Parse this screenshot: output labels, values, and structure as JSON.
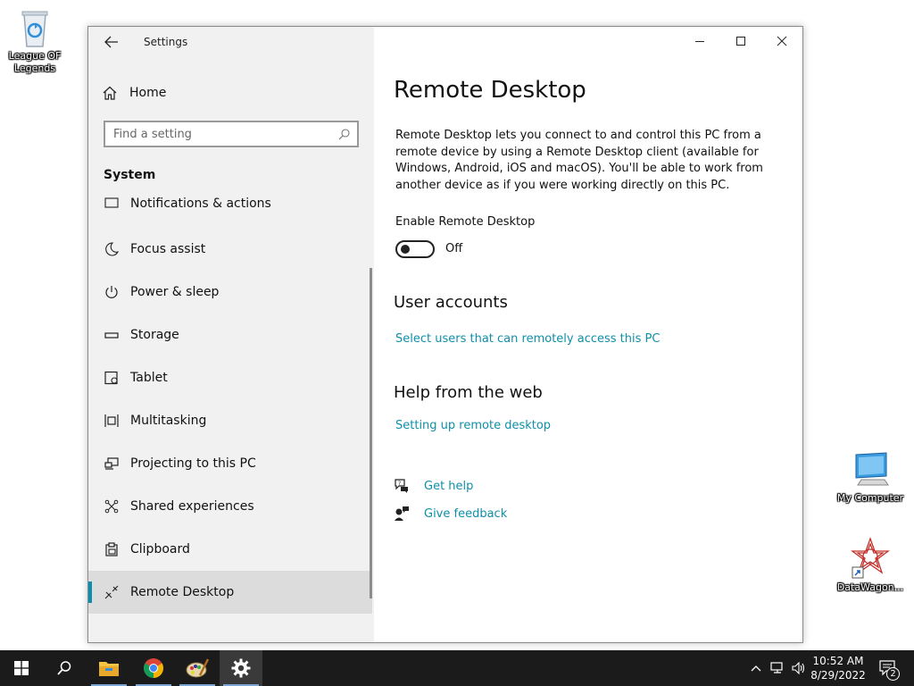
{
  "desktop": {
    "icons": [
      {
        "label": "League OF Legends",
        "icon": "recycle-bin-icon"
      },
      {
        "label": "My Computer",
        "icon": "computer-icon"
      },
      {
        "label": "DataWagon...",
        "icon": "datawagon-shortcut-icon"
      }
    ]
  },
  "window": {
    "title": "Settings",
    "controls": [
      "minimize-icon",
      "maximize-icon",
      "close-icon"
    ]
  },
  "sidebar": {
    "home_label": "Home",
    "search_placeholder": "Find a setting",
    "section_title": "System",
    "items": [
      {
        "label": "Notifications & actions",
        "icon": "notifications-icon",
        "selected": false
      },
      {
        "label": "Focus assist",
        "icon": "moon-icon",
        "selected": false
      },
      {
        "label": "Power & sleep",
        "icon": "power-icon",
        "selected": false
      },
      {
        "label": "Storage",
        "icon": "storage-icon",
        "selected": false
      },
      {
        "label": "Tablet",
        "icon": "tablet-icon",
        "selected": false
      },
      {
        "label": "Multitasking",
        "icon": "multitasking-icon",
        "selected": false
      },
      {
        "label": "Projecting to this PC",
        "icon": "projecting-icon",
        "selected": false
      },
      {
        "label": "Shared experiences",
        "icon": "shared-experiences-icon",
        "selected": false
      },
      {
        "label": "Clipboard",
        "icon": "clipboard-icon",
        "selected": false
      },
      {
        "label": "Remote Desktop",
        "icon": "remote-desktop-icon",
        "selected": true
      }
    ]
  },
  "main": {
    "title": "Remote Desktop",
    "description": "Remote Desktop lets you connect to and control this PC from a remote device by using a Remote Desktop client (available for Windows, Android, iOS and macOS). You'll be able to work from another device as if you were working directly on this PC.",
    "toggle_label": "Enable Remote Desktop",
    "toggle_state": "Off",
    "user_accounts_heading": "User accounts",
    "user_accounts_link": "Select users that can remotely access this PC",
    "help_heading": "Help from the web",
    "help_link": "Setting up remote desktop",
    "get_help": "Get help",
    "give_feedback": "Give feedback"
  },
  "taskbar": {
    "apps": [
      "start-icon",
      "search-icon",
      "file-explorer-icon",
      "chrome-icon",
      "paint-icon",
      "settings-icon"
    ],
    "active_app": "settings-icon",
    "time": "10:52 AM",
    "date": "8/29/2022",
    "notification_count": "2"
  },
  "colors": {
    "accent": "#0a8fb0",
    "link": "#0f8fa8",
    "sidebar_bg": "#f1f1f1",
    "taskbar_bg": "#1b1b1b"
  }
}
